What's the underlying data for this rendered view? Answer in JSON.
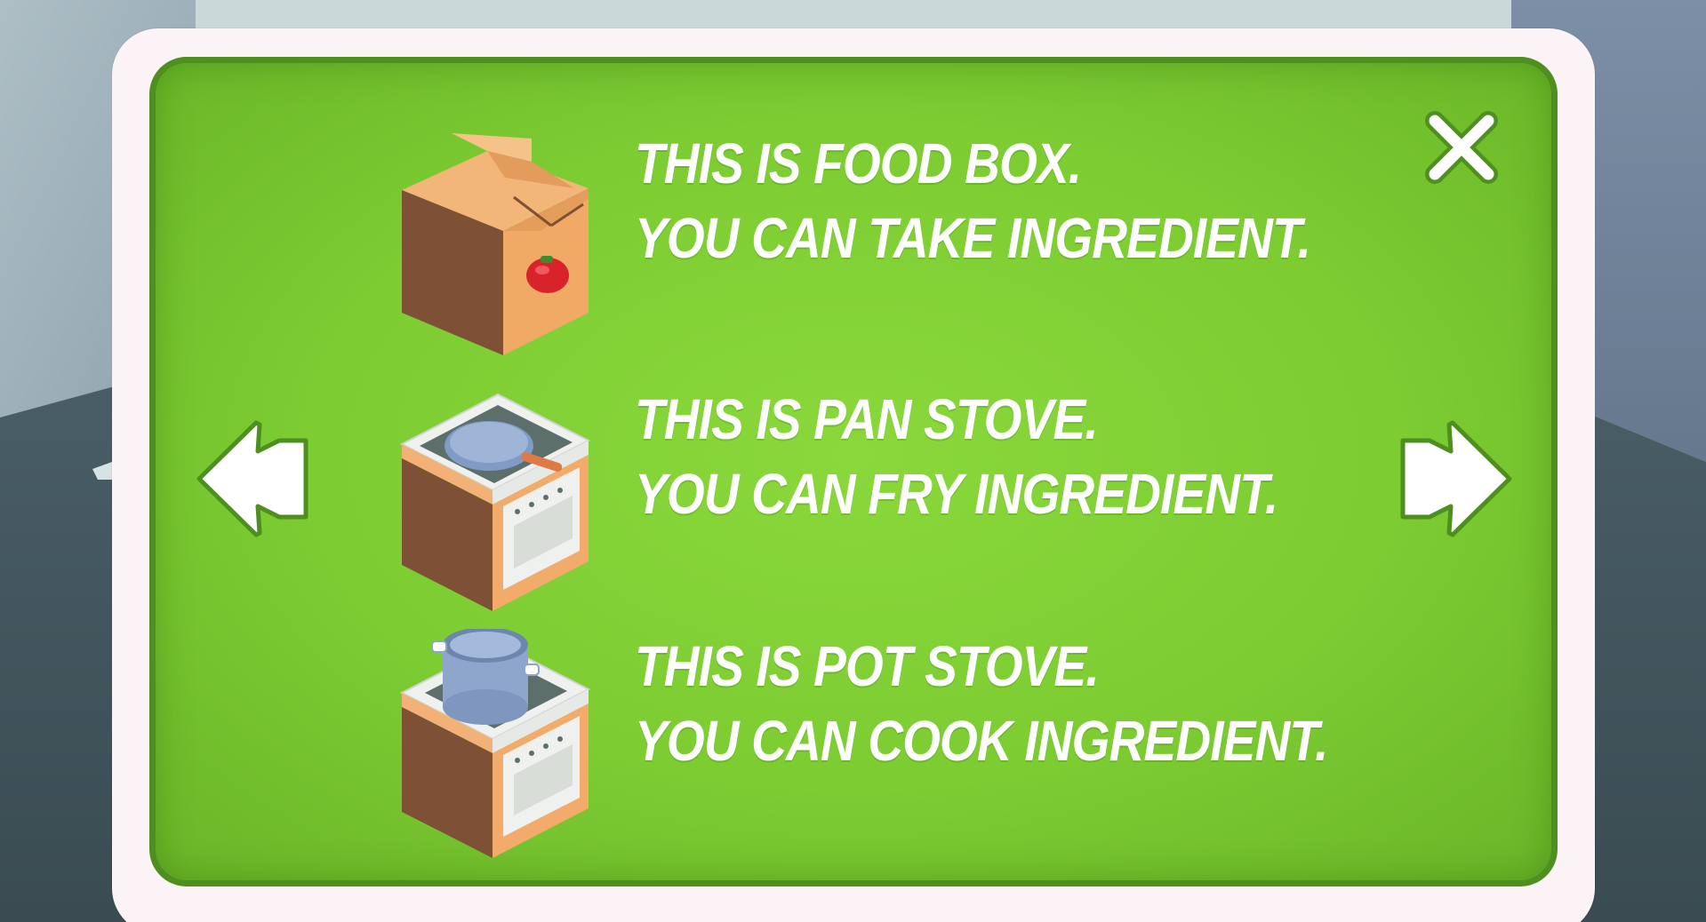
{
  "panel": {
    "close_icon": "close-x-icon",
    "prev_icon": "arrow-left-icon",
    "next_icon": "arrow-right-icon",
    "accent_green": "#7ccc32",
    "border_green": "#4e8f20",
    "frame_color": "#fcf3f6"
  },
  "items": [
    {
      "icon": "food-box-icon",
      "line1": "THIS IS FOOD BOX.",
      "line2": "YOU CAN TAKE INGREDIENT."
    },
    {
      "icon": "pan-stove-icon",
      "line1": "THIS IS PAN STOVE.",
      "line2": "YOU CAN FRY INGREDIENT."
    },
    {
      "icon": "pot-stove-icon",
      "line1": "THIS IS POT STOVE.",
      "line2": "YOU CAN COOK INGREDIENT."
    }
  ]
}
